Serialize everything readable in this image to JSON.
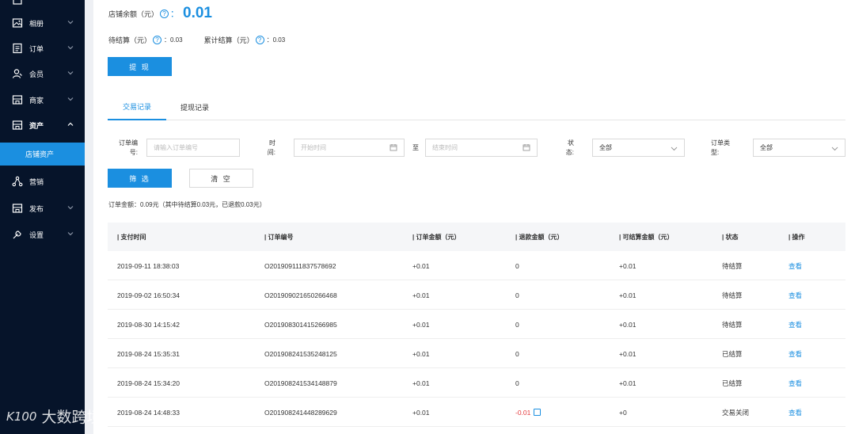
{
  "sidebar": {
    "items": [
      {
        "label": "相册",
        "icon": "image-icon"
      },
      {
        "label": "订单",
        "icon": "order-icon"
      },
      {
        "label": "会员",
        "icon": "member-icon"
      },
      {
        "label": "商家",
        "icon": "store-icon"
      },
      {
        "label": "资产",
        "icon": "assets-icon"
      },
      {
        "label": "店铺资产",
        "icon": ""
      },
      {
        "label": "营销",
        "icon": "marketing-icon"
      },
      {
        "label": "发布",
        "icon": "publish-icon"
      },
      {
        "label": "设置",
        "icon": "settings-icon"
      }
    ]
  },
  "balance": {
    "label": "店铺余额（元）",
    "value": "0.01",
    "colon": "："
  },
  "pending": {
    "label": "待结算（元）",
    "value": "：0.03"
  },
  "cumulative": {
    "label": "累计结算（元）",
    "value": "：0.03"
  },
  "withdraw_btn": "提 现",
  "tabs": [
    "交易记录",
    "提现记录"
  ],
  "filters": {
    "order_no_label": "订单编号:",
    "order_no_placeholder": "请输入订单编号",
    "time_label": "时间:",
    "start_placeholder": "开始时间",
    "to_label": "至",
    "end_placeholder": "结束时间",
    "status_label": "状态:",
    "status_value": "全部",
    "type_label": "订单类型:",
    "type_value": "全部"
  },
  "buttons": {
    "filter": "筛 选",
    "clear": "清 空"
  },
  "summary": "订单金额：0.09元（其中待结算0.03元，已退款0.03元）",
  "table": {
    "headers": [
      "| 支付时间",
      "| 订单编号",
      "| 订单金额（元）",
      "| 退款金额（元）",
      "| 可结算金额（元）",
      "| 状态",
      "| 操作"
    ],
    "rows": [
      {
        "time": "2019-09-11 18:38:03",
        "order": "O201909111837578692",
        "amount": "+0.01",
        "refund": "0",
        "settle": "+0.01",
        "status": "待结算",
        "action": "查看"
      },
      {
        "time": "2019-09-02 16:50:34",
        "order": "O201909021650266468",
        "amount": "+0.01",
        "refund": "0",
        "settle": "+0.01",
        "status": "待结算",
        "action": "查看"
      },
      {
        "time": "2019-08-30 14:15:42",
        "order": "O201908301415266985",
        "amount": "+0.01",
        "refund": "0",
        "settle": "+0.01",
        "status": "待结算",
        "action": "查看"
      },
      {
        "time": "2019-08-24 15:35:31",
        "order": "O201908241535248125",
        "amount": "+0.01",
        "refund": "0",
        "settle": "+0.01",
        "status": "已结算",
        "action": "查看"
      },
      {
        "time": "2019-08-24 15:34:20",
        "order": "O201908241534148879",
        "amount": "+0.01",
        "refund": "0",
        "settle": "+0.01",
        "status": "已结算",
        "action": "查看"
      },
      {
        "time": "2019-08-24 14:48:33",
        "order": "O201908241448289629",
        "amount": "+0.01",
        "refund": "-0.01",
        "settle": "+0",
        "status": "交易关闭",
        "action": "查看"
      }
    ]
  },
  "watermark": {
    "logo": "K100",
    "text": "大数跨境"
  },
  "colors": {
    "accent": "#1b8fe0",
    "sidebar_bg": "#06142a",
    "negative": "#e4393c"
  }
}
